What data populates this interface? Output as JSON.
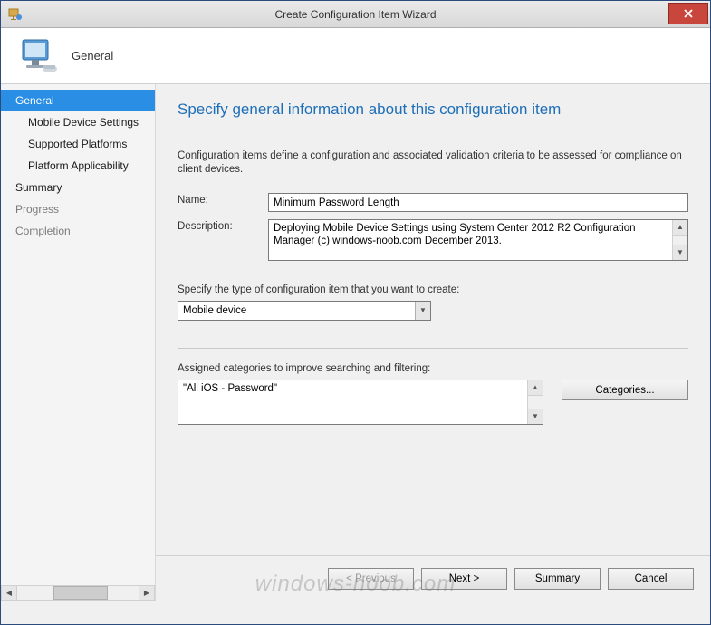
{
  "window": {
    "title": "Create Configuration Item Wizard",
    "close": "X"
  },
  "header": {
    "label": "General"
  },
  "sidebar": {
    "steps": [
      {
        "label": "General",
        "selected": true,
        "sub": false
      },
      {
        "label": "Mobile Device Settings",
        "selected": false,
        "sub": true
      },
      {
        "label": "Supported Platforms",
        "selected": false,
        "sub": true
      },
      {
        "label": "Platform Applicability",
        "selected": false,
        "sub": true
      },
      {
        "label": "Summary",
        "selected": false,
        "sub": false
      },
      {
        "label": "Progress",
        "selected": false,
        "sub": false,
        "dim": true
      },
      {
        "label": "Completion",
        "selected": false,
        "sub": false,
        "dim": true
      }
    ]
  },
  "main": {
    "title": "Specify general information about this configuration item",
    "intro": "Configuration items define a configuration and associated validation criteria to be assessed for compliance on client devices.",
    "name_label": "Name:",
    "name_value": "Minimum Password Length",
    "description_label": "Description:",
    "description_value": "Deploying Mobile Device Settings using System Center 2012 R2 Configuration Manager (c) windows-noob.com December 2013.",
    "type_label": "Specify the type of configuration item that you want to create:",
    "type_value": "Mobile device",
    "categories_label": "Assigned categories to improve searching and filtering:",
    "categories_value": "\"All iOS - Password\"",
    "categories_button": "Categories..."
  },
  "buttons": {
    "previous": "< Previous",
    "next": "Next >",
    "summary": "Summary",
    "cancel": "Cancel"
  },
  "watermark": "windows-noob.com"
}
